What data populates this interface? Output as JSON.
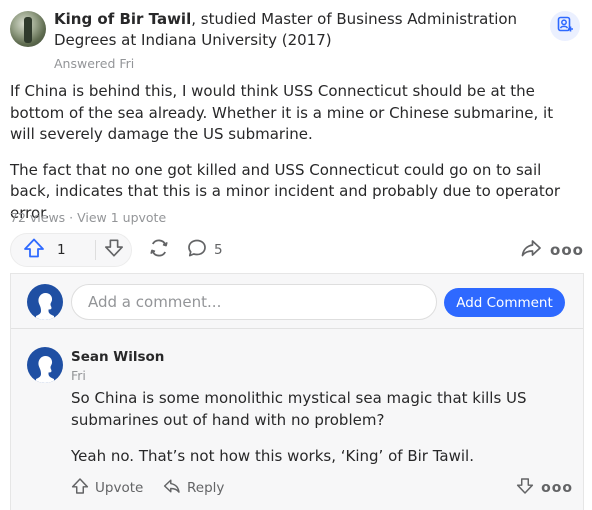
{
  "answer": {
    "author_name": "King of Bir Tawil",
    "credential": ", studied Master of Business Administration Degrees at Indiana University (2017)",
    "answered_label": "Answered Fri",
    "paragraphs": [
      "If China is behind this, I would think USS Connecticut should be at the bottom of the sea already. Whether it is a mine or Chinese submarine, it will severely damage the US submarine.",
      "The fact that no one got killed and USS Connecticut could go on to sail back, indicates that this is a minor incident and probably due to operator error."
    ],
    "stats": "72 views · View 1 upvote"
  },
  "actions": {
    "upvote_count": "1",
    "comment_count": "5",
    "more_label": "ooo"
  },
  "compose": {
    "placeholder": "Add a comment...",
    "submit_label": "Add Comment"
  },
  "comment": {
    "author": "Sean Wilson",
    "time": "Fri",
    "paragraphs": [
      "So China is some monolithic mystical sea magic that kills US submarines out of hand with no problem?",
      "Yeah no. That’s not how this works, ‘King’ of Bir Tawil."
    ],
    "upvote_label": "Upvote",
    "reply_label": "Reply",
    "more_label": "ooo"
  },
  "colors": {
    "accent": "#2e69ff",
    "avatar_blue": "#1f4fa3",
    "muted_text": "#939598",
    "panel_bg": "#f7f7f8"
  },
  "icons": [
    "follow-person-icon",
    "upvote-arrow-icon",
    "downvote-arrow-icon",
    "share-cycle-icon",
    "comment-bubble-icon",
    "forward-share-icon",
    "more-dots-icon",
    "default-avatar-icon",
    "reply-icon"
  ]
}
